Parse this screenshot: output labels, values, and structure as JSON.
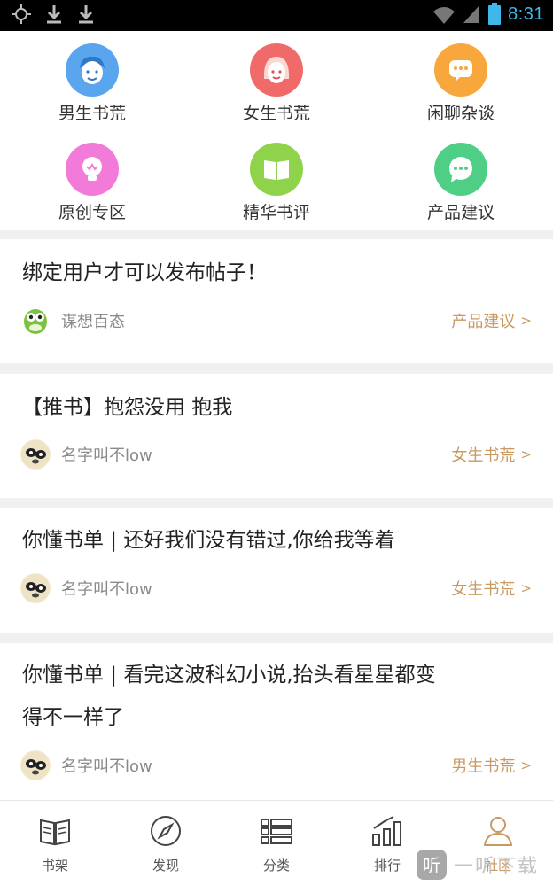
{
  "status_bar": {
    "time": "8:31"
  },
  "categories": [
    {
      "label": "男生书荒",
      "color": "#5aa6ee",
      "icon": "boy-face-icon"
    },
    {
      "label": "女生书荒",
      "color": "#f06a6a",
      "icon": "girl-face-icon"
    },
    {
      "label": "闲聊杂谈",
      "color": "#f8a73c",
      "icon": "chat-bubble-icon"
    },
    {
      "label": "原创专区",
      "color": "#f27ad8",
      "icon": "lightbulb-icon"
    },
    {
      "label": "精华书评",
      "color": "#8fd34a",
      "icon": "open-book-icon"
    },
    {
      "label": "产品建议",
      "color": "#4fcf86",
      "icon": "message-icon"
    }
  ],
  "posts": [
    {
      "title": "绑定用户才可以发布帖子！",
      "author": "谋想百态",
      "tag": "产品建议",
      "avatar": "green-mascot-avatar"
    },
    {
      "title": "【推书】抱怨没用 抱我",
      "author": "名字叫不low",
      "tag": "女生书荒",
      "avatar": "panda-avatar"
    },
    {
      "title": "你懂书单 | 还好我们没有错过,你给我等着",
      "author": "名字叫不low",
      "tag": "女生书荒",
      "avatar": "panda-avatar"
    },
    {
      "title_line1": "你懂书单 | 看完这波科幻小说,抬头看星星都变",
      "title_line2": "得不一样了",
      "author": "名字叫不low",
      "tag": "男生书荒",
      "avatar": "panda-avatar"
    }
  ],
  "chevron": ">",
  "bottom_nav": [
    {
      "label": "书架",
      "icon": "bookshelf-icon"
    },
    {
      "label": "发现",
      "icon": "compass-icon"
    },
    {
      "label": "分类",
      "icon": "list-icon"
    },
    {
      "label": "排行",
      "icon": "ranking-icon"
    },
    {
      "label": "社区",
      "icon": "person-icon",
      "active": true
    }
  ],
  "watermark": {
    "logo": "听",
    "text": "一听下载"
  },
  "colors": {
    "accent": "#c89a62",
    "time": "#3fb7ea"
  }
}
